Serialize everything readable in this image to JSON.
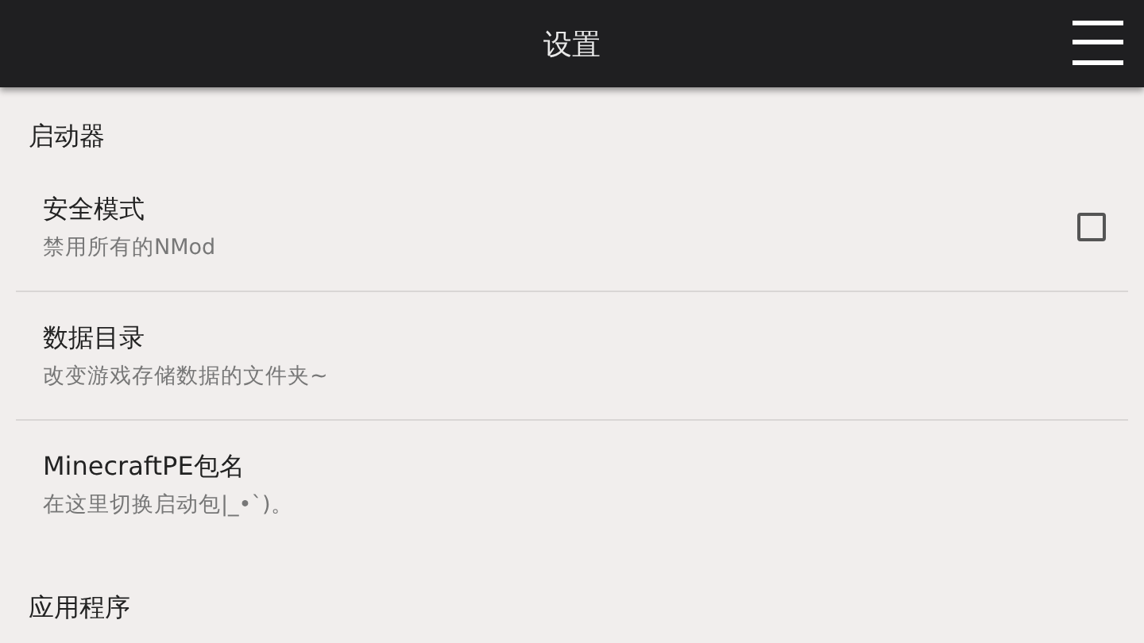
{
  "app_bar": {
    "title": "设置"
  },
  "sections": [
    {
      "title": "启动器",
      "items": [
        {
          "kind": "checkbox",
          "title": "安全模式",
          "summary": "禁用所有的NMod",
          "checked": false
        },
        {
          "kind": "plain",
          "title": "数据目录",
          "summary": "改变游戏存储数据的文件夹~"
        },
        {
          "kind": "plain",
          "title": "MinecraftPE包名",
          "summary": "在这里切换启动包|_•`)。"
        }
      ]
    },
    {
      "title": "应用程序"
    }
  ]
}
